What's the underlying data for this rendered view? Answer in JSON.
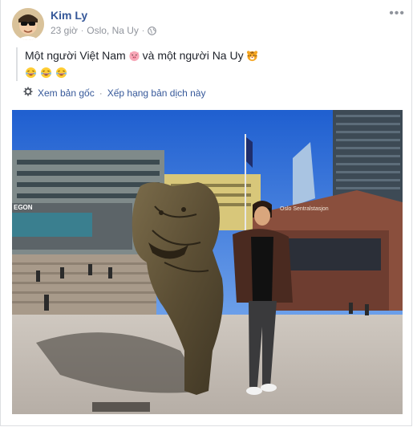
{
  "post": {
    "author": "Kim Ly",
    "time": "23 giờ",
    "location": "Oslo, Na Uy",
    "menu_icon": "more-dots-icon",
    "text_part1": "Một người Việt Nam",
    "text_part2": "và một người Na Uy",
    "emoji_pig": "pig-face-emoji",
    "emoji_tiger": "tiger-face-emoji",
    "laugh_emojis": [
      "laughing-emoji",
      "laughing-emoji",
      "laughing-emoji"
    ]
  },
  "translation": {
    "see_original": "Xem bản gốc",
    "separator": "·",
    "rate": "Xếp hạng bản dịch này"
  },
  "photo": {
    "building_sign": "EGON",
    "station_sign": "Oslo Sentralstasjon"
  },
  "colors": {
    "link": "#365899",
    "meta": "#90949c",
    "sky": "#2d6fd8"
  }
}
